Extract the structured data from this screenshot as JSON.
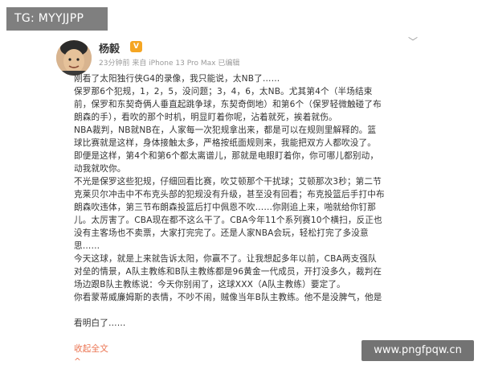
{
  "tag": "TG: MYYJJPP",
  "post": {
    "author": "杨毅",
    "badge": "V",
    "meta": "23分钟前 来自 iPhone 13 Pro Max  已编辑",
    "paragraphs": [
      "刚看了太阳独行侠G4的录像，我只能说，太NB了……",
      "保罗那6个犯规，1，2，5，没问题；3，4，6，太NB。尤其第4个（半场结束\n前，保罗和东契奇俩人垂直起跳争球，东契奇倒地）和第6个（保罗轻微触碰了布\n朗森的手），看吹的那个时机，明显盯着你呢，沾着就死，挨着就伤。",
      "NBA裁判，NB就NB在，人家每一次犯规拿出来，都是可以在规则里解释的。篮\n球比赛就是这样，身体接触太多，严格按纸面规则来，我能把双方人都吹没了。\n即便是这样，第4个和第6个都太离谱儿，那就是电眼盯着你，你可哪儿都别动，\n动我就吹你。",
      "不光是保罗这些犯规，仔细回看比赛，吹艾顿那个干扰球；艾顿那次3秒；第二节\n克莱贝尔冲击中不布克头部的犯规没有升级，甚至没有回看；布克投篮后手打中布\n朗森吹违体，第三节布朗森投篮后打中佩恩不吹……你刚追上来，啪就给你钉那\n儿。太厉害了。CBA现在都不这么干了。CBA今年11个系列赛10个横扫，反正也\n没有主客场也不卖票，大家打完完了。还是人家NBA会玩，轻松打完了多没意\n思……",
      "今天这球，就是上来就告诉太阳，你赢不了。让我想起多年以前，CBA两支强队\n对垒的情景，A队主教练和B队主教练都是96黄金一代成员，开打没多久，裁判在\n场边跟B队主教练说：今天你别闹了，这球XXX（A队主教练）要定了。",
      "你看蒙蒂威廉姆斯的表情，不吵不闹，贼像当年B队主教练。他不是没脾气，他是"
    ],
    "tail_text": "看明白了……",
    "collapse_label": "收起全文",
    "collapse_arrow": "^",
    "more_glyph": "﹀"
  },
  "watermark": "www.pngfpqw.cn"
}
